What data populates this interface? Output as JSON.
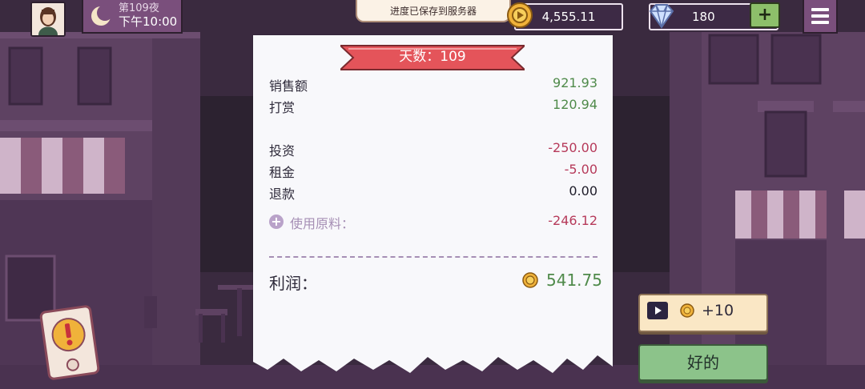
{
  "hud": {
    "night_label": "第109夜",
    "time_label": "下午10:00",
    "save_toast": "进度已保存到服务器",
    "coins": "4,555.11",
    "gems": "180",
    "add_gems_symbol": "+"
  },
  "receipt": {
    "day_title": "天数：109",
    "rows": [
      {
        "label": "销售额",
        "value": "921.93",
        "tone": "positive"
      },
      {
        "label": "打赏",
        "value": "120.94",
        "tone": "positive"
      },
      {
        "label": "投资",
        "value": "-250.00",
        "tone": "negative"
      },
      {
        "label": "租金",
        "value": "-5.00",
        "tone": "negative"
      },
      {
        "label": "退款",
        "value": "0.00",
        "tone": "neutral"
      },
      {
        "label": "使用原料：",
        "value": "-246.12",
        "tone": "negative"
      }
    ],
    "profit_label": "利润：",
    "profit_value": "541.75"
  },
  "buttons": {
    "ad_reward": "+10",
    "ok": "好的"
  },
  "colors": {
    "positive": "#4f8a4a",
    "negative": "#b63a5a",
    "accent_ribbon": "#e4545a",
    "ok_green": "#8cc38a"
  },
  "icons": [
    "moon-icon",
    "coin-icon",
    "gem-icon",
    "menu-icon",
    "video-play-icon",
    "alert-icon"
  ]
}
